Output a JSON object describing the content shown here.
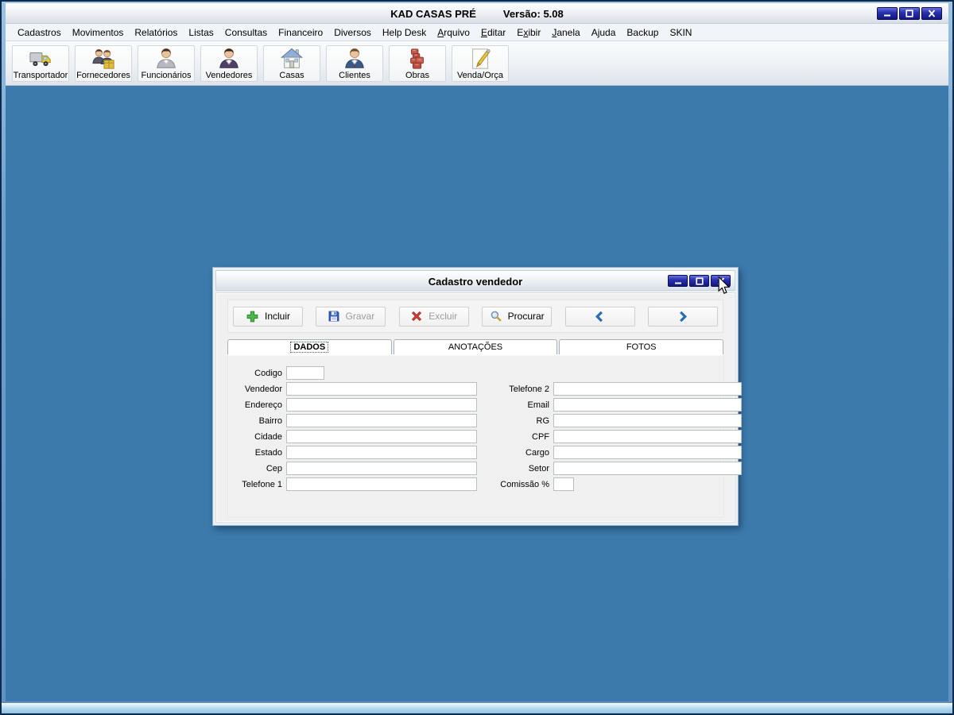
{
  "window": {
    "title": "KAD CASAS PRÉ",
    "version_label": "Versão: 5.08",
    "controls": [
      "minimize",
      "maximize",
      "close"
    ]
  },
  "menubar": {
    "items": [
      {
        "label": "Cadastros"
      },
      {
        "label": "Movimentos"
      },
      {
        "label": "Relatórios"
      },
      {
        "label": "Listas"
      },
      {
        "label": "Consultas"
      },
      {
        "label": "Financeiro"
      },
      {
        "label": "Diversos"
      },
      {
        "label": "Help Desk"
      },
      {
        "label": "Arquivo",
        "underline": 0
      },
      {
        "label": "Editar",
        "underline": 0
      },
      {
        "label": "Exibir",
        "underline": 1
      },
      {
        "label": "Janela",
        "underline": 0
      },
      {
        "label": "Ajuda"
      },
      {
        "label": "Backup"
      },
      {
        "label": "SKIN"
      }
    ]
  },
  "toolbar": {
    "buttons": [
      {
        "label": "Transportador",
        "icon": "truck-icon"
      },
      {
        "label": "Fornecedores",
        "icon": "suppliers-icon"
      },
      {
        "label": "Funcionários",
        "icon": "employee-icon"
      },
      {
        "label": "Vendedores",
        "icon": "salesperson-icon"
      },
      {
        "label": "Casas",
        "icon": "house-icon"
      },
      {
        "label": "Clientes",
        "icon": "client-icon"
      },
      {
        "label": "Obras",
        "icon": "bricks-icon"
      },
      {
        "label": "Venda/Orça",
        "icon": "sale-quote-icon"
      }
    ]
  },
  "dialog": {
    "title": "Cadastro vendedor",
    "controls": [
      "minimize",
      "maximize",
      "close"
    ],
    "buttons": [
      {
        "label": "Incluir",
        "icon": "add-icon",
        "disabled": false
      },
      {
        "label": "Gravar",
        "icon": "save-icon",
        "disabled": true
      },
      {
        "label": "Excluir",
        "icon": "delete-icon",
        "disabled": true
      },
      {
        "label": "Procurar",
        "icon": "search-icon",
        "disabled": false
      },
      {
        "label": "",
        "icon": "prev-icon",
        "disabled": false,
        "name": "previous-record-button"
      },
      {
        "label": "",
        "icon": "next-icon",
        "disabled": false,
        "name": "next-record-button"
      }
    ],
    "tabs": [
      {
        "label": "DADOS",
        "active": true
      },
      {
        "label": "ANOTAÇÕES",
        "active": false
      },
      {
        "label": "FOTOS",
        "active": false
      }
    ],
    "form": {
      "left": [
        {
          "label": "Codigo",
          "value": "",
          "size": "tiny"
        },
        {
          "label": "Vendedor",
          "value": ""
        },
        {
          "label": "Endereço",
          "value": ""
        },
        {
          "label": "Bairro",
          "value": ""
        },
        {
          "label": "Cidade",
          "value": ""
        },
        {
          "label": "Estado",
          "value": ""
        },
        {
          "label": "Cep",
          "value": ""
        },
        {
          "label": "Telefone 1",
          "value": ""
        }
      ],
      "right": [
        {
          "label": "Telefone 2",
          "value": ""
        },
        {
          "label": "Email",
          "value": ""
        },
        {
          "label": "RG",
          "value": ""
        },
        {
          "label": "CPF",
          "value": ""
        },
        {
          "label": "Cargo",
          "value": ""
        },
        {
          "label": "Setor",
          "value": ""
        },
        {
          "label": "Comissão %",
          "value": "",
          "size": "tiny"
        }
      ]
    }
  },
  "colors": {
    "desktop_bg": "#3C7AAB",
    "frame_outer": "#0D2A4D",
    "control_button_navy": "#141B94",
    "disabled_text": "#9C9C9C",
    "chevron_blue": "#2B6CB8",
    "titlebar_text": "#000000"
  }
}
